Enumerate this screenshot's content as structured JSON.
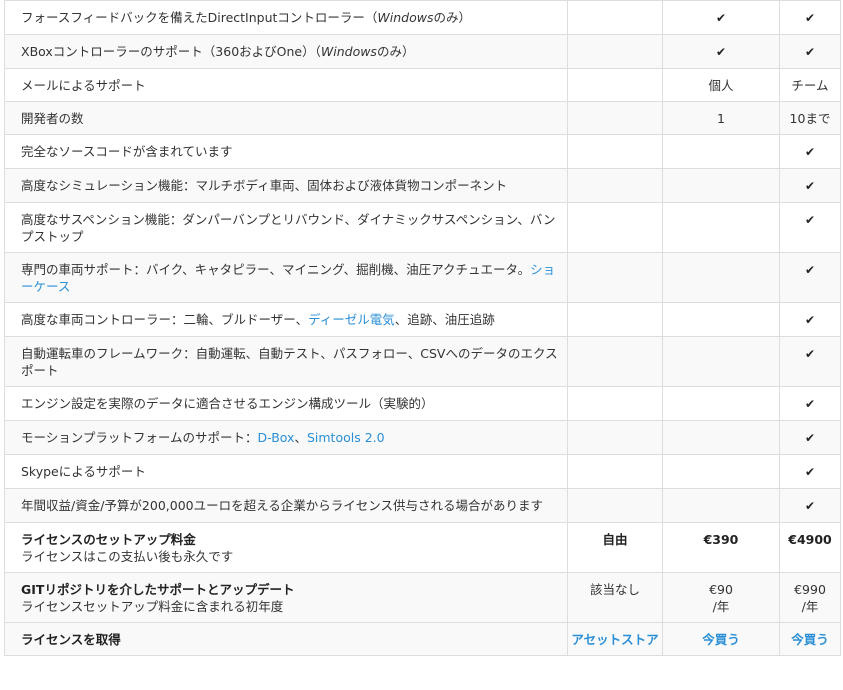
{
  "rows": [
    {
      "parts": [
        {
          "t": "フォースフィードバックを備えたDirectInputコントローラー（"
        },
        {
          "t": "Windows",
          "i": true
        },
        {
          "t": "のみ）"
        }
      ],
      "c2": "✔",
      "c3": "✔"
    },
    {
      "parts": [
        {
          "t": "XBoxコントローラーのサポート（360およびOne）（"
        },
        {
          "t": "Windows",
          "i": true
        },
        {
          "t": "のみ）"
        }
      ],
      "c2": "✔",
      "c3": "✔"
    },
    {
      "parts": [
        {
          "t": "メールによるサポート"
        }
      ],
      "c2": "個人",
      "c3": "チーム"
    },
    {
      "parts": [
        {
          "t": "開発者の数"
        }
      ],
      "c2": "1",
      "c3": "10まで"
    },
    {
      "parts": [
        {
          "t": "完全なソースコードが含まれています"
        }
      ],
      "c2": "",
      "c3": "✔"
    },
    {
      "parts": [
        {
          "t": "高度なシミュレーション機能：マルチボディ車両、固体および液体貨物コンポーネント"
        }
      ],
      "c2": "",
      "c3": "✔"
    },
    {
      "parts": [
        {
          "t": "高度なサスペンション機能：ダンパーバンプとリバウンド、ダイナミックサスペンション、バンプストップ"
        }
      ],
      "c2": "",
      "c3": "✔"
    },
    {
      "parts": [
        {
          "t": "専門の車両サポート：バイク、キャタピラー、マイニング、掘削機、油圧アクチュエータ。"
        },
        {
          "t": "ショーケース",
          "link": true
        }
      ],
      "c2": "",
      "c3": "✔"
    },
    {
      "parts": [
        {
          "t": "高度な車両コントローラー：二輪、ブルドーザー、"
        },
        {
          "t": "ディーゼル電気",
          "link": true
        },
        {
          "t": "、追跡、油圧追跡"
        }
      ],
      "c2": "",
      "c3": "✔"
    },
    {
      "parts": [
        {
          "t": "自動運転車のフレームワーク：自動運転、自動テスト、パスフォロー、CSVへのデータのエクスポート"
        }
      ],
      "c2": "",
      "c3": "✔"
    },
    {
      "parts": [
        {
          "t": "エンジン設定を実際のデータに適合させるエンジン構成ツール（実験的）"
        }
      ],
      "c2": "",
      "c3": "✔"
    },
    {
      "parts": [
        {
          "t": "モーションプラットフォームのサポート："
        },
        {
          "t": "D-Box",
          "link": true
        },
        {
          "t": "、"
        },
        {
          "t": "Simtools 2.0",
          "link": true
        }
      ],
      "c2": "",
      "c3": "✔"
    },
    {
      "parts": [
        {
          "t": "Skypeによるサポート"
        }
      ],
      "c2": "",
      "c3": "✔"
    },
    {
      "parts": [
        {
          "t": "年間収益/資金/予算が200,000ユーロを超える企業からライセンス供与される場合があります"
        }
      ],
      "c2": "",
      "c3": "✔"
    }
  ],
  "setup_fee": {
    "title": "ライセンスのセットアップ料金",
    "sub": "ライセンスはこの支払い後も永久です",
    "c1": "自由",
    "c2": "€390",
    "c3": "€4900"
  },
  "git": {
    "title": "GITリポジトリを介したサポートとアップデート",
    "sub": "ライセンスセットアップ料金に含まれる初年度",
    "c1": "該当なし",
    "c2": "€90\n/年",
    "c3": "€990\n/年"
  },
  "get_license": {
    "title": "ライセンスを取得",
    "c1": "アセットストア",
    "c2": "今買う",
    "c3": "今買う"
  }
}
